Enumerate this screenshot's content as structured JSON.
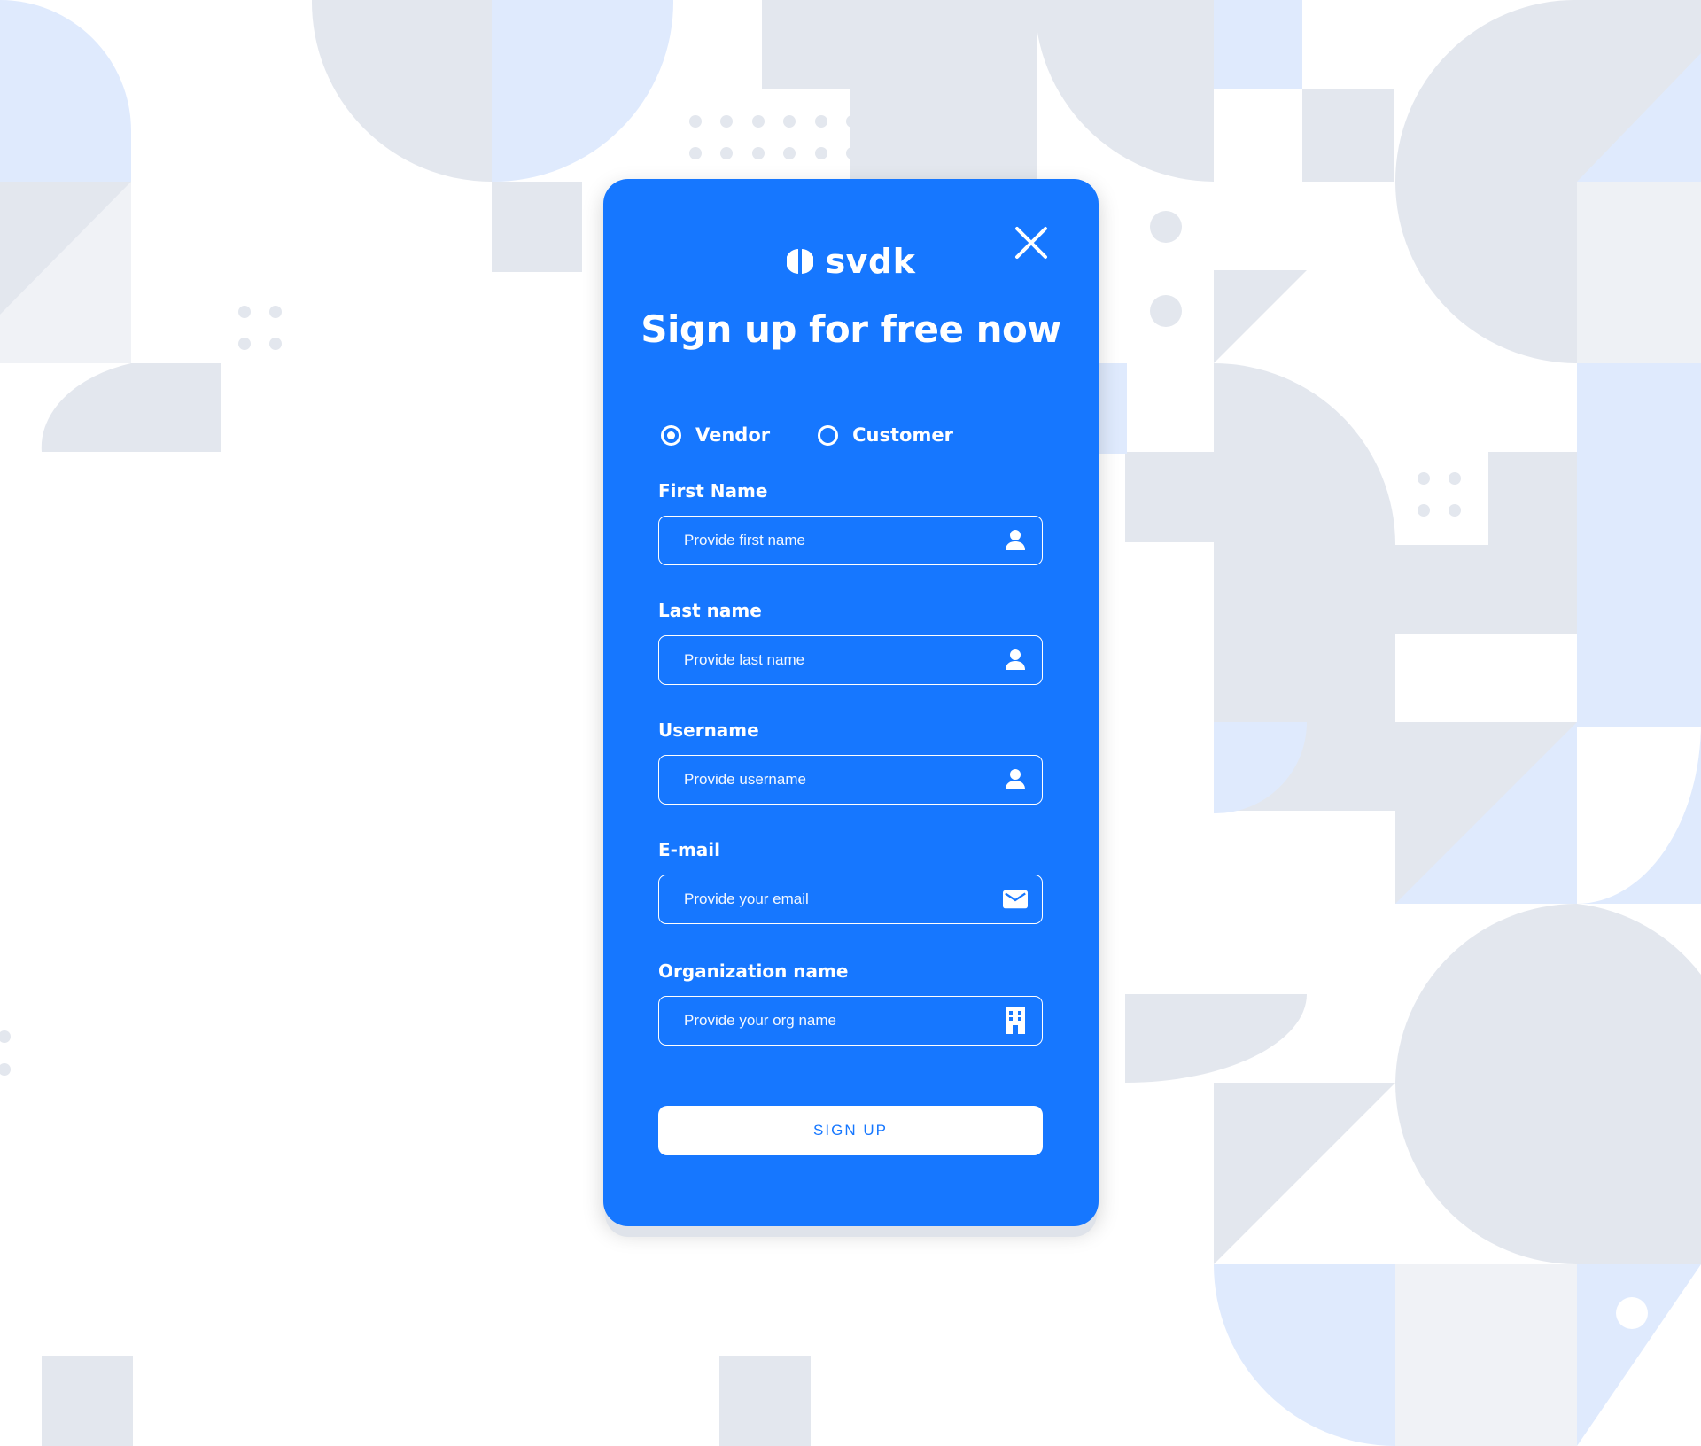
{
  "colors": {
    "accent": "#1677ff",
    "background_shape": "#e3e7ee",
    "background_shape_light": "#dfeafd"
  },
  "brand": {
    "name": "svdk",
    "logo_icon": "half-circle-logo-icon"
  },
  "modal": {
    "title": "Sign up for free now",
    "close_icon": "close-icon"
  },
  "account_type": {
    "options": [
      {
        "label": "Vendor",
        "selected": true
      },
      {
        "label": "Customer",
        "selected": false
      }
    ]
  },
  "fields": {
    "first_name": {
      "label": "First Name",
      "placeholder": "Provide first name",
      "icon": "user-icon"
    },
    "last_name": {
      "label": "Last name",
      "placeholder": "Provide last name",
      "icon": "user-icon"
    },
    "username": {
      "label": "Username",
      "placeholder": "Provide username",
      "icon": "user-icon"
    },
    "email": {
      "label": "E-mail",
      "placeholder": "Provide your email",
      "icon": "mail-icon"
    },
    "organization": {
      "label": "Organization name",
      "placeholder": "Provide your org name",
      "icon": "building-icon"
    }
  },
  "submit": {
    "label": "SIGN UP"
  }
}
